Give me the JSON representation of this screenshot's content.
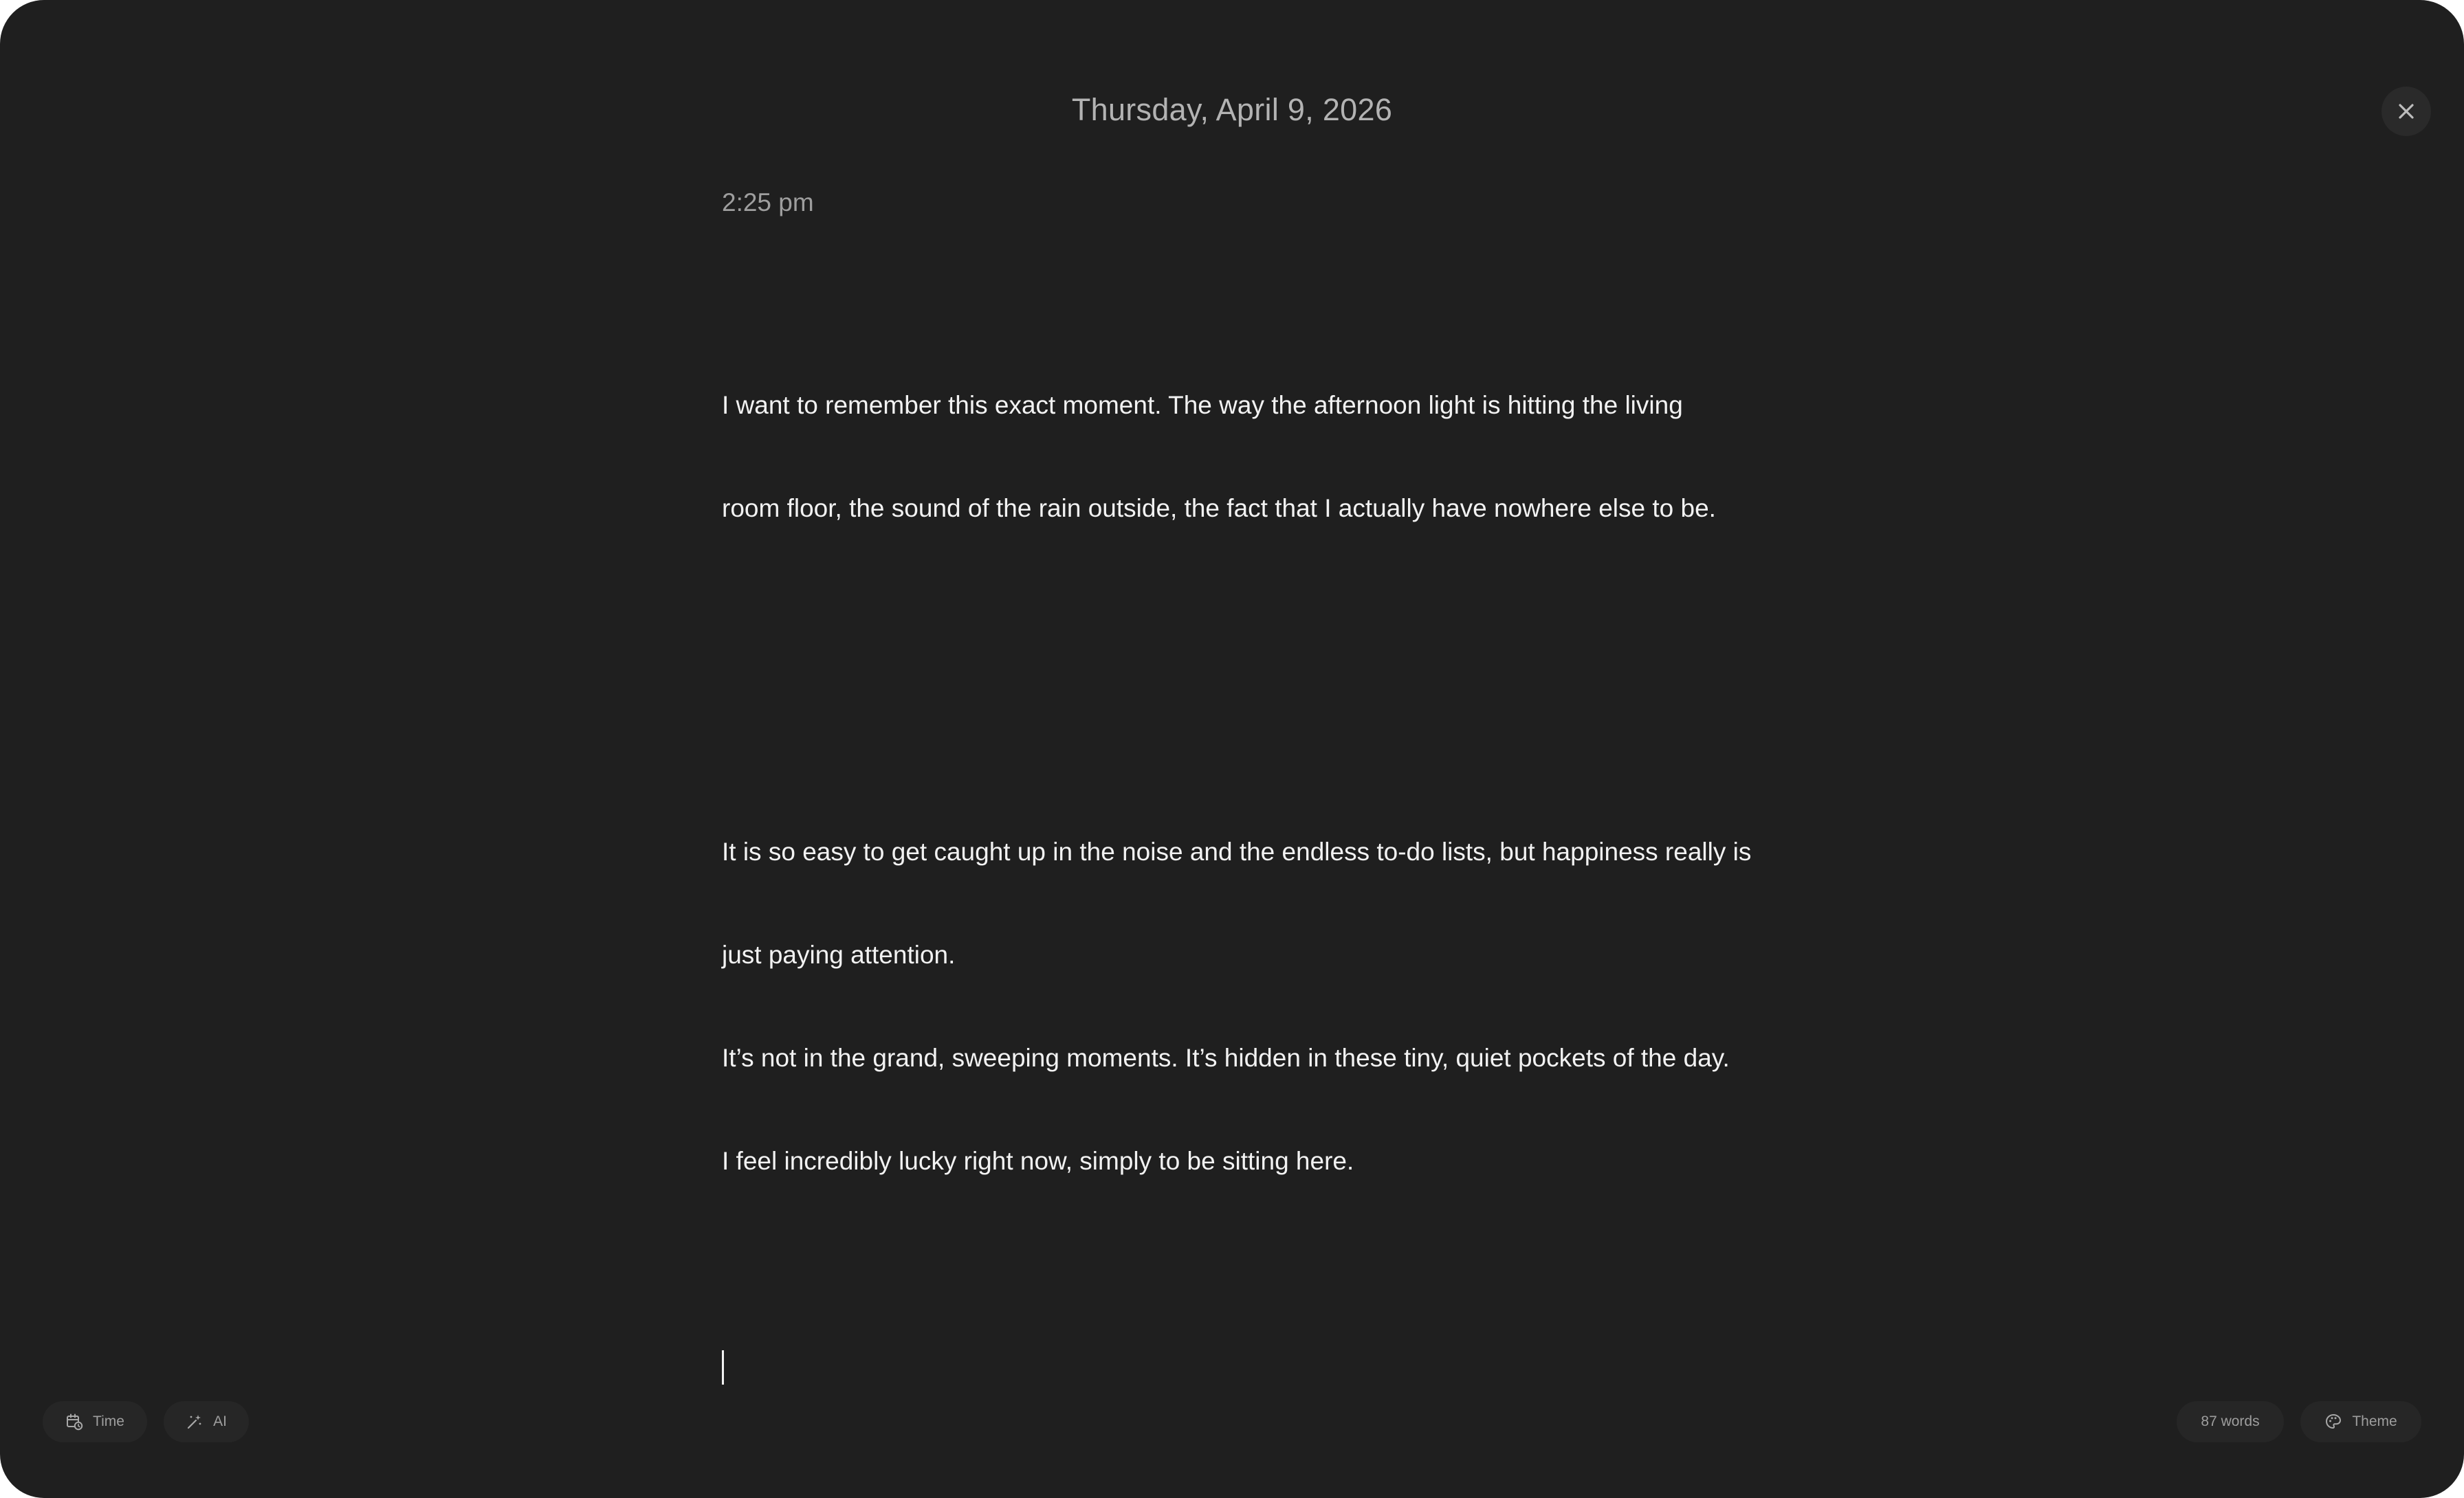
{
  "header": {
    "date": "Thursday, April 9, 2026",
    "close_icon": "close-icon"
  },
  "entry": {
    "time": "2:25 pm",
    "paragraphs": [
      [
        "I want to remember this exact moment. The way the afternoon light is hitting the living",
        "room floor, the sound of the rain outside, the fact that I actually have nowhere else to be."
      ],
      [
        "It is so easy to get caught up in the noise and the endless to-do lists, but happiness really is",
        "just paying attention.",
        "It’s not in the grand, sweeping moments. It’s hidden in these tiny, quiet pockets of the day.",
        "I feel incredibly lucky right now, simply to be sitting here."
      ]
    ]
  },
  "footer": {
    "time_button": {
      "label": "Time",
      "icon": "calendar-clock-icon"
    },
    "ai_button": {
      "label": "AI",
      "icon": "magic-wand-icon"
    },
    "word_count": "87 words",
    "theme_button": {
      "label": "Theme",
      "icon": "palette-icon"
    }
  },
  "colors": {
    "background": "#1f1f1f",
    "text": "#f2f2f2",
    "muted": "#9e9e9e",
    "pill": "#262626"
  }
}
